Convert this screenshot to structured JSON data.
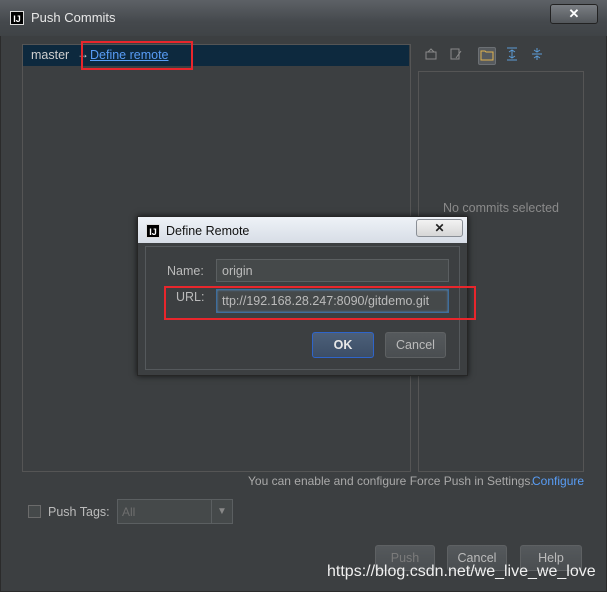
{
  "window": {
    "title": "Push Commits",
    "logo_text": "IJ",
    "close_glyph": "✕"
  },
  "branch": {
    "name": "master",
    "arrow": "→",
    "define_remote_link": "Define remote"
  },
  "toolbar": {
    "icons": [
      "cloud-icon",
      "edit-icon",
      "folder-icon",
      "expand-icon",
      "collapse-icon"
    ]
  },
  "details": {
    "empty_text": "No commits selected"
  },
  "force_push": {
    "note": "You can enable and configure Force Push in Settings.",
    "configure_link": "Configure"
  },
  "push_tags": {
    "label": "Push Tags:",
    "checked": false,
    "value": "All"
  },
  "buttons": {
    "push": "Push",
    "cancel": "Cancel",
    "help": "Help"
  },
  "dialog": {
    "title": "Define Remote",
    "logo_text": "IJ",
    "close_glyph": "✕",
    "name_label": "Name:",
    "name_value": "origin",
    "url_label": "URL:",
    "url_value": "ttp://192.168.28.247:8090/gitdemo.git",
    "ok": "OK",
    "cancel": "Cancel"
  },
  "watermark": "https://blog.csdn.net/we_live_we_love",
  "colors": {
    "link": "#589df6",
    "highlight": "#e8262c",
    "background": "#3c3f41",
    "selection": "#0d293e"
  }
}
